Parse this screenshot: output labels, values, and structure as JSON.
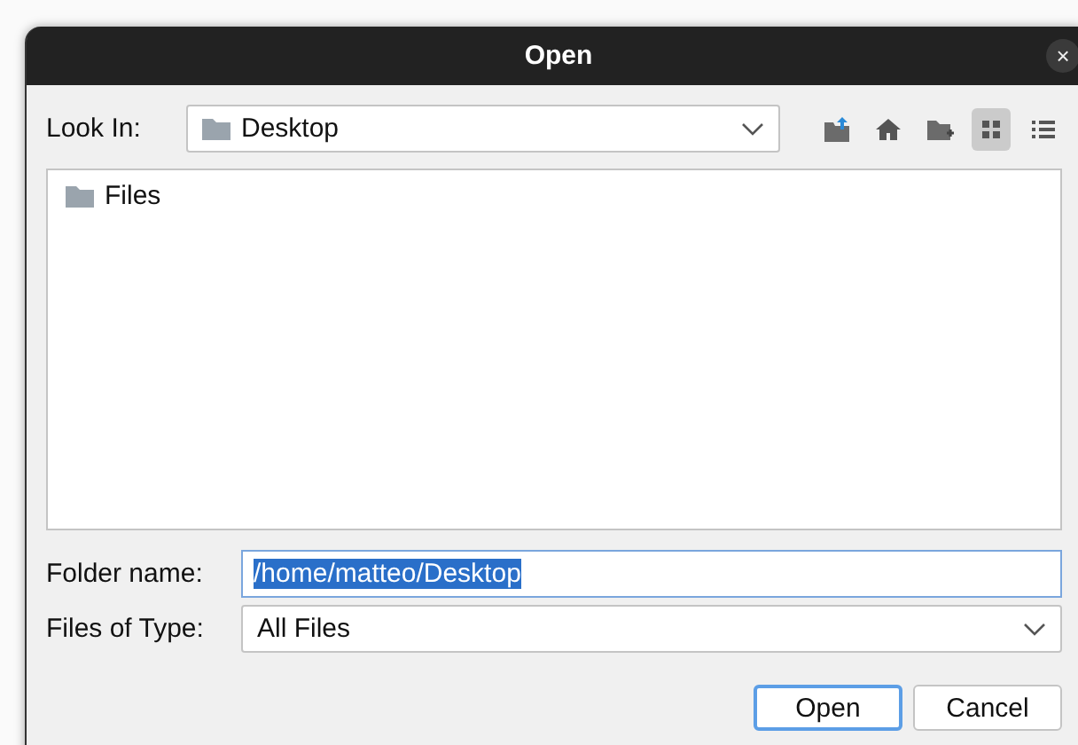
{
  "window": {
    "title": "Open",
    "close": "×"
  },
  "look_in": {
    "label": "Look In:",
    "value": "Desktop"
  },
  "toolbar": [
    {
      "kind": "up",
      "selected": false
    },
    {
      "kind": "home",
      "selected": false
    },
    {
      "kind": "new-folder",
      "selected": false
    },
    {
      "kind": "grid",
      "selected": true
    },
    {
      "kind": "list",
      "selected": false
    }
  ],
  "files": [
    {
      "name": "Files",
      "selected": false
    }
  ],
  "folder_name": {
    "label": "Folder name:",
    "value": "/home/matteo/Desktop",
    "text_selected": true
  },
  "file_type": {
    "label": "Files of Type:",
    "value": "All Files"
  },
  "buttons": [
    {
      "label": "Open",
      "default": true
    },
    {
      "label": "Cancel",
      "default": false
    }
  ]
}
